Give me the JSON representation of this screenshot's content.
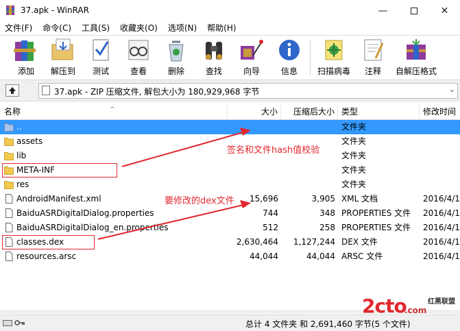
{
  "window": {
    "title": "37.apk - WinRAR"
  },
  "menu": [
    "文件(F)",
    "命令(C)",
    "工具(S)",
    "收藏夹(O)",
    "选项(N)",
    "帮助(H)"
  ],
  "toolbar": {
    "add": "添加",
    "extract_to": "解压到",
    "test": "测试",
    "view": "查看",
    "delete": "删除",
    "find": "查找",
    "wizard": "向导",
    "info": "信息",
    "virus_scan": "扫描病毒",
    "comment": "注释",
    "sfx": "自解压格式"
  },
  "address": {
    "text": "37.apk - ZIP 压缩文件, 解包大小为 180,929,968 字节"
  },
  "columns": {
    "name": "名称",
    "size": "大小",
    "packed": "压缩后大小",
    "type": "类型",
    "modified": "修改时间"
  },
  "files": [
    {
      "name": "..",
      "size": "",
      "packed": "",
      "type": "文件夹",
      "modified": "",
      "icon": "folder-up"
    },
    {
      "name": "assets",
      "size": "",
      "packed": "",
      "type": "文件夹",
      "modified": "",
      "icon": "folder"
    },
    {
      "name": "lib",
      "size": "",
      "packed": "",
      "type": "文件夹",
      "modified": "",
      "icon": "folder"
    },
    {
      "name": "META-INF",
      "size": "",
      "packed": "",
      "type": "文件夹",
      "modified": "",
      "icon": "folder"
    },
    {
      "name": "res",
      "size": "",
      "packed": "",
      "type": "文件夹",
      "modified": "",
      "icon": "folder"
    },
    {
      "name": "AndroidManifest.xml",
      "size": "15,696",
      "packed": "3,905",
      "type": "XML 文档",
      "modified": "2016/4/1",
      "icon": "file"
    },
    {
      "name": "BaiduASRDigitalDialog.properties",
      "size": "744",
      "packed": "348",
      "type": "PROPERTIES 文件",
      "modified": "2016/4/1",
      "icon": "file"
    },
    {
      "name": "BaiduASRDigitalDialog_en.properties",
      "size": "512",
      "packed": "258",
      "type": "PROPERTIES 文件",
      "modified": "2016/4/1",
      "icon": "file"
    },
    {
      "name": "classes.dex",
      "size": "2,630,464",
      "packed": "1,127,244",
      "type": "DEX 文件",
      "modified": "2016/4/1",
      "icon": "file"
    },
    {
      "name": "resources.arsc",
      "size": "44,044",
      "packed": "44,044",
      "type": "ARSC 文件",
      "modified": "2016/4/1",
      "icon": "file"
    }
  ],
  "annotations": {
    "meta_inf": "签名和文件hash值校验",
    "dex": "要修改的dex文件"
  },
  "status": {
    "text": "总计 4 文件夹 和 2,691,460 字节(5 个文件)"
  },
  "watermark": {
    "main": "2cto",
    "suffix": ".com",
    "sub": "红黑联盟"
  },
  "colors": {
    "selection": "#3399ff",
    "annotation": "#e0282e",
    "folder": "#f2c94c"
  }
}
